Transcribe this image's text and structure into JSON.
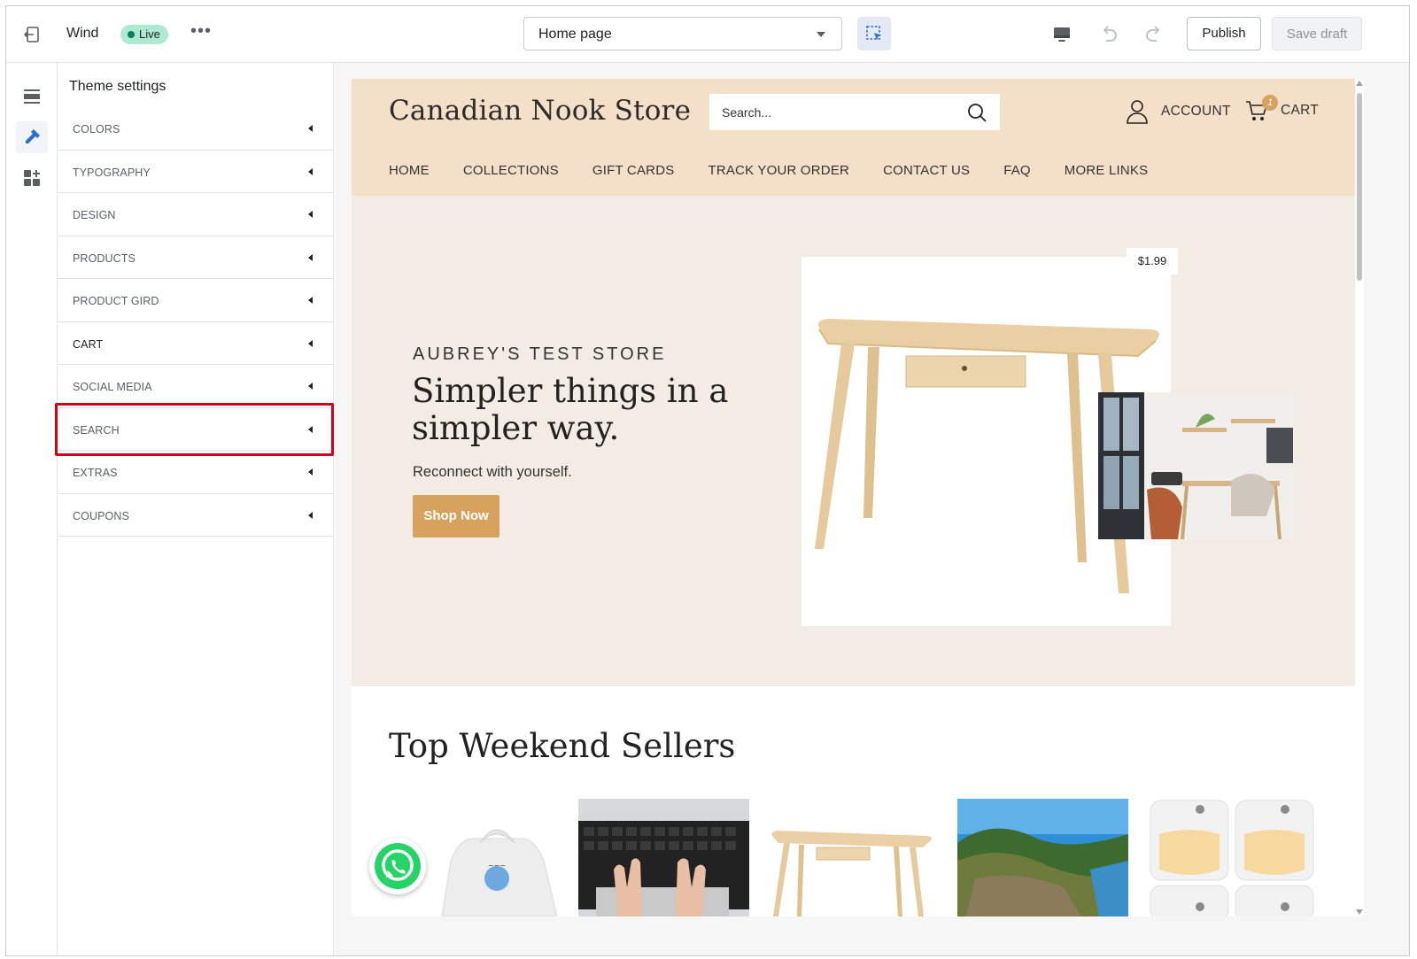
{
  "topbar": {
    "theme_name": "Wind",
    "status_badge": "Live",
    "more_label": "•••",
    "page_select": "Home page",
    "publish_label": "Publish",
    "save_draft_label": "Save draft"
  },
  "rail": {
    "items": [
      {
        "icon": "sections-icon"
      },
      {
        "icon": "theme-settings-icon",
        "active": true
      },
      {
        "icon": "apps-icon"
      }
    ]
  },
  "panel": {
    "title": "Theme settings",
    "items": [
      {
        "label": "COLORS"
      },
      {
        "label": "TYPOGRAPHY"
      },
      {
        "label": "DESIGN"
      },
      {
        "label": "PRODUCTS"
      },
      {
        "label": "PRODUCT GIRD"
      },
      {
        "label": "CART"
      },
      {
        "label": "SOCIAL MEDIA"
      },
      {
        "label": "SEARCH",
        "highlighted": true
      },
      {
        "label": "EXTRAS"
      },
      {
        "label": "COUPONS"
      }
    ]
  },
  "store": {
    "name": "Canadian Nook Store",
    "search_placeholder": "Search...",
    "account_label": "ACCOUNT",
    "cart_label": "CART",
    "cart_count": "1",
    "nav": [
      "HOME",
      "COLLECTIONS",
      "GIFT CARDS",
      "TRACK YOUR ORDER",
      "CONTACT US",
      "FAQ",
      "MORE LINKS"
    ],
    "hero": {
      "eyebrow": "AUBREY'S TEST STORE",
      "title": "Simpler things in a simpler way.",
      "subtitle": "Reconnect with yourself.",
      "button": "Shop Now",
      "price": "$1.99"
    },
    "sellers_title": "Top Weekend Sellers"
  },
  "colors": {
    "accent": "#d7a25e",
    "header_bg": "#f4e0c8",
    "hero_bg": "#f3ece5",
    "highlight_border": "#d4001a",
    "live_badge_bg": "#aee9d1"
  }
}
